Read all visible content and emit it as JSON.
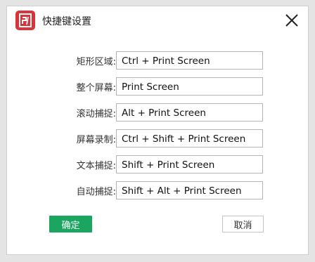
{
  "dialog": {
    "title": "快捷键设置",
    "logo_icon": "app-logo-icon",
    "close_icon": "close-icon"
  },
  "shortcuts": [
    {
      "label": "矩形区域:",
      "value": "Ctrl + Print Screen"
    },
    {
      "label": "整个屏幕:",
      "value": "Print Screen"
    },
    {
      "label": "滚动捕捉:",
      "value": "Alt + Print Screen"
    },
    {
      "label": "屏幕录制:",
      "value": "Ctrl + Shift + Print Screen"
    },
    {
      "label": "文本捕捉:",
      "value": "Shift + Print Screen"
    },
    {
      "label": "自动捕捉:",
      "value": "Shift + Alt + Print Screen"
    }
  ],
  "buttons": {
    "ok_label": "确定",
    "cancel_label": "取消"
  },
  "colors": {
    "ok_button": "#1aa660",
    "logo": "#d9343a"
  }
}
